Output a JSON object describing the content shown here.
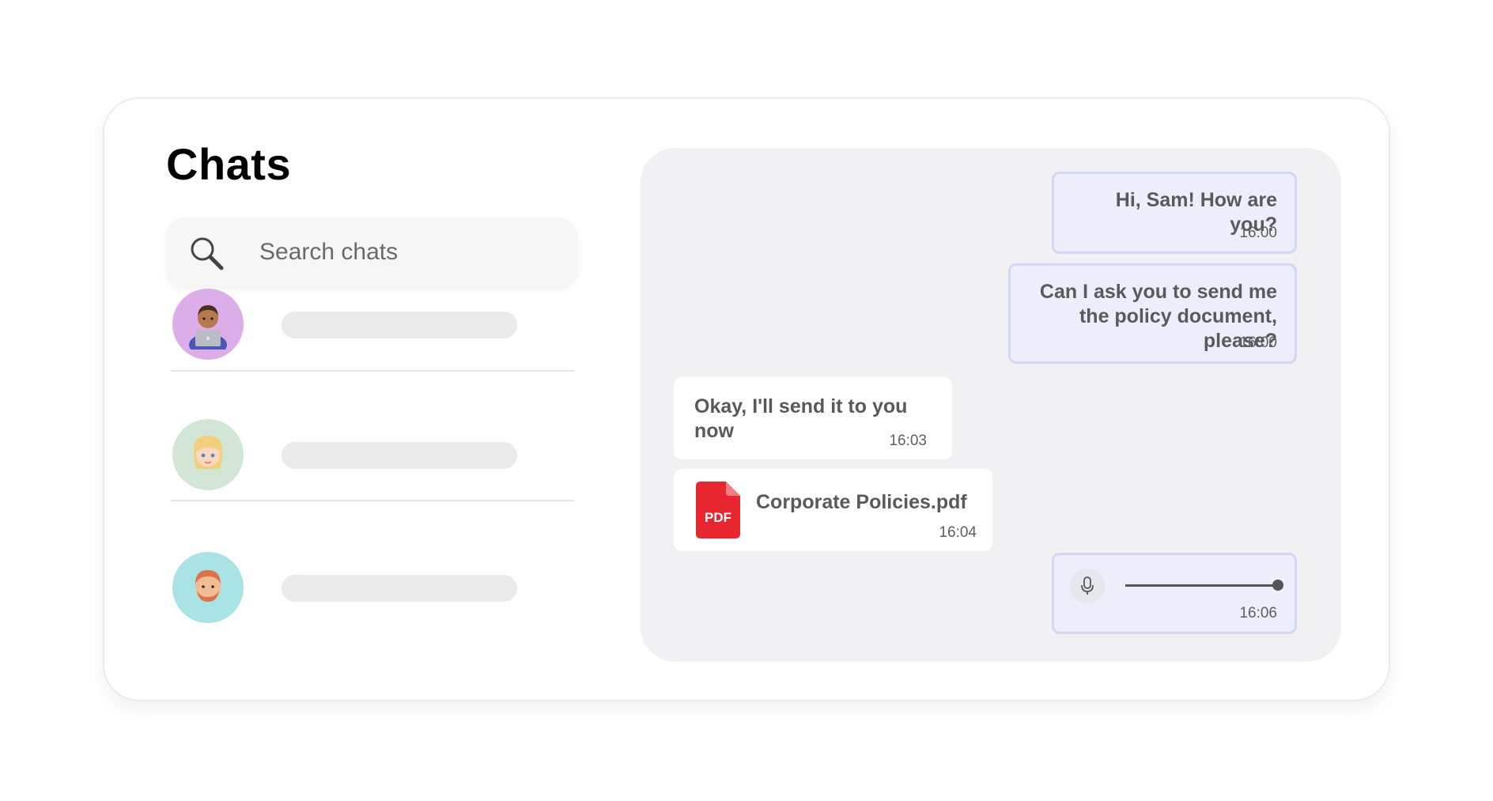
{
  "header": {
    "title": "Chats"
  },
  "search": {
    "placeholder": "Search chats"
  },
  "chat_list": [
    {
      "avatar_icon": "man-technologist-emoji",
      "avatar_bg": "#dcaee9"
    },
    {
      "avatar_icon": "blonde-woman-emoji",
      "avatar_bg": "#d3e6d6"
    },
    {
      "avatar_icon": "red-haired-man-emoji",
      "avatar_bg": "#a9e3e6"
    }
  ],
  "conversation": {
    "messages": [
      {
        "direction": "outgoing",
        "text": "Hi, Sam! How are you?",
        "time": "16:00"
      },
      {
        "direction": "outgoing",
        "text": "Can I ask you to send me the policy document, please?",
        "time": "16:00"
      },
      {
        "direction": "incoming",
        "text": "Okay, I'll send it to you now",
        "time": "16:03"
      },
      {
        "direction": "incoming",
        "type": "file",
        "file_icon": "pdf-icon",
        "file_badge": "PDF",
        "file_name": "Corporate Policies.pdf",
        "time": "16:04"
      },
      {
        "direction": "outgoing",
        "type": "voice",
        "icon": "microphone-icon",
        "progress": 1.0,
        "time": "16:06"
      }
    ]
  },
  "colors": {
    "outgoing_bubble": "#eceefb",
    "outgoing_border": "#d3d6f5",
    "incoming_bubble": "#ffffff",
    "conversation_bg": "#f1f1f4",
    "pdf_red": "#e8262f"
  }
}
